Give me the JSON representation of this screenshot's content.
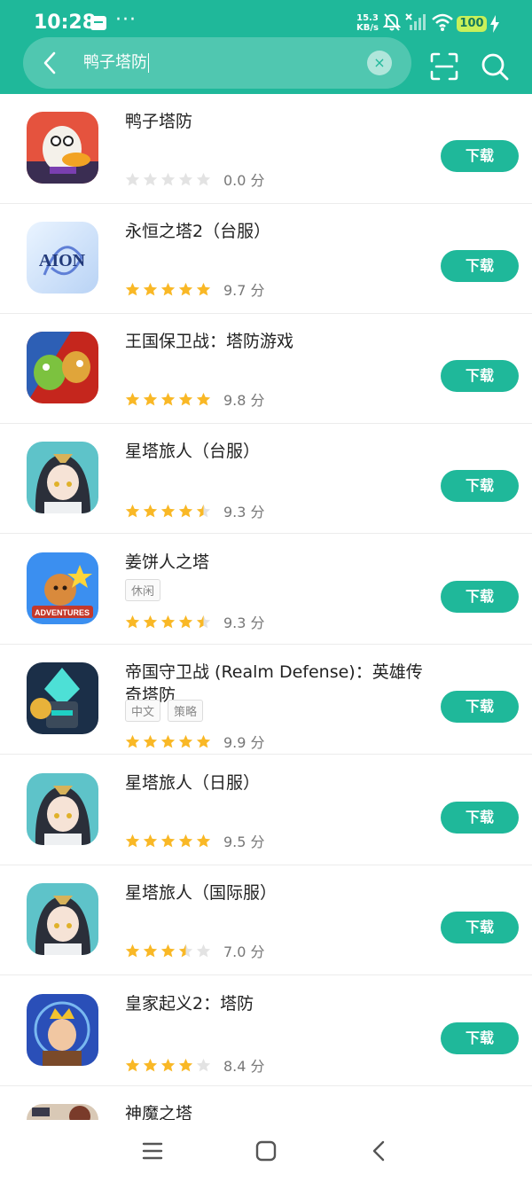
{
  "status_bar": {
    "time": "10:28",
    "dots": "···",
    "speed_value": "15.3",
    "speed_unit": "KB/s",
    "battery": "100"
  },
  "search": {
    "query": "鸭子塔防"
  },
  "colors": {
    "brand": "#1fb89a",
    "star_filled": "#f9b826",
    "star_empty": "#e3e3e3"
  },
  "download_label": "下载",
  "apps": [
    {
      "title": "鸭子塔防",
      "tags": [],
      "rating": 0.0,
      "score_text": "0.0 分",
      "icon": "duck-game-icon"
    },
    {
      "title": "永恒之塔2（台服）",
      "tags": [],
      "rating": 5,
      "score_text": "9.7 分",
      "icon": "aion-icon"
    },
    {
      "title": "王国保卫战：塔防游戏",
      "tags": [],
      "rating": 5,
      "score_text": "9.8 分",
      "icon": "kingdom-rush-icon"
    },
    {
      "title": "星塔旅人（台服）",
      "tags": [],
      "rating": 4.5,
      "score_text": "9.3 分",
      "icon": "anime-girl-icon"
    },
    {
      "title": "姜饼人之塔",
      "tags": [
        "休闲"
      ],
      "rating": 4.5,
      "score_text": "9.3 分",
      "icon": "cookie-icon"
    },
    {
      "title": "帝国守卫战 (Realm Defense)：英雄传奇塔防",
      "tags": [
        "中文",
        "策略"
      ],
      "rating": 5,
      "score_text": "9.9 分",
      "icon": "realm-defense-icon"
    },
    {
      "title": "星塔旅人（日服）",
      "tags": [],
      "rating": 5,
      "score_text": "9.5 分",
      "icon": "anime-girl-icon"
    },
    {
      "title": "星塔旅人（国际服）",
      "tags": [],
      "rating": 3.5,
      "score_text": "7.0 分",
      "icon": "anime-girl-icon"
    },
    {
      "title": "皇家起义2：塔防",
      "tags": [],
      "rating": 4,
      "score_text": "8.4 分",
      "icon": "royal-revolt-icon"
    },
    {
      "title": "神魔之塔",
      "tags": [],
      "rating": 0,
      "score_text": "",
      "icon": "tower-of-saviors-icon"
    }
  ]
}
